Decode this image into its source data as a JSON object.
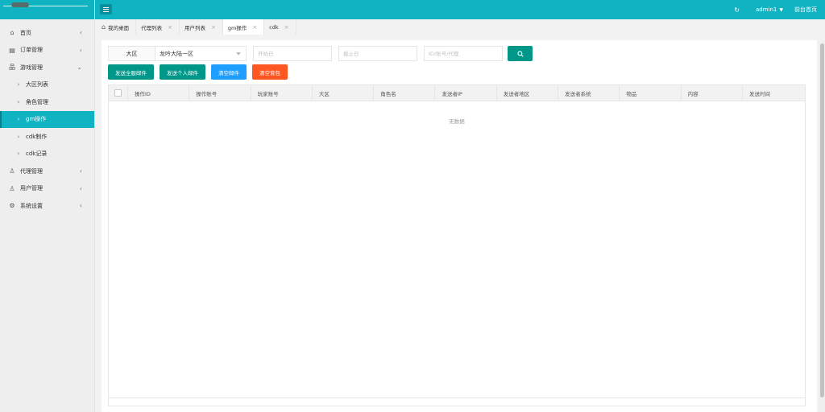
{
  "sidebar": {
    "items": [
      {
        "label": "首页",
        "icon": "home-icon"
      },
      {
        "label": "订单管理",
        "icon": "order-icon"
      },
      {
        "label": "游戏管理",
        "icon": "sitemap-icon"
      },
      {
        "label": "大区列表"
      },
      {
        "label": "角色管理"
      },
      {
        "label": "gm操作"
      },
      {
        "label": "cdk制作"
      },
      {
        "label": "cdk记录"
      },
      {
        "label": "代理管理",
        "icon": "user-icon"
      },
      {
        "label": "用户管理",
        "icon": "user-icon"
      },
      {
        "label": "系统设置",
        "icon": "gear-icon"
      }
    ]
  },
  "header": {
    "user": "admin1",
    "front_link": "前台首页"
  },
  "tabs": [
    {
      "label": "我的桌面"
    },
    {
      "label": "代理列表"
    },
    {
      "label": "用户列表"
    },
    {
      "label": "gm操作"
    },
    {
      "label": "cdk"
    }
  ],
  "filters": {
    "region_label": "大区",
    "region_value": "龙吟大陆一区",
    "start_placeholder": "开始日",
    "end_placeholder": "截止日",
    "id_placeholder": "ID/账号/代理"
  },
  "actions": {
    "send_all": "发送全服邮件",
    "send_personal": "发送个人邮件",
    "clear_mail": "清空邮件",
    "clear_bag": "清空背包"
  },
  "table": {
    "columns": [
      "操作ID",
      "操作账号",
      "玩家账号",
      "大区",
      "角色名",
      "发送者IP",
      "发送者地区",
      "发送者系统",
      "物品",
      "内容",
      "发送时间"
    ],
    "empty_text": "无数据"
  },
  "colors": {
    "primary": "#0fb3c2",
    "green": "#009688",
    "blue": "#1e9fff",
    "orange": "#ff5722"
  }
}
